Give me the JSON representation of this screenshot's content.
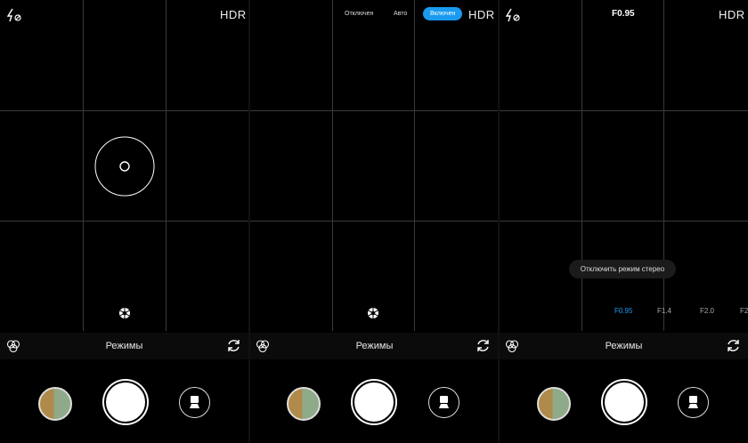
{
  "panels": [
    {
      "flash_icon": "flash-off-icon",
      "hdr": "HDR",
      "modes_label": "Режимы"
    },
    {
      "hdr": "HDR",
      "hdr_options": [
        "Отключен",
        "Авто",
        "Включен"
      ],
      "hdr_selected": "Включен",
      "modes_label": "Режимы"
    },
    {
      "flash_icon": "flash-off-icon",
      "hdr": "HDR",
      "aperture_current": "F0.95",
      "stereo_toggle": "Отключить режим стерео",
      "apertures": [
        "F0.95",
        "F1.4",
        "F2.0",
        "F2"
      ],
      "aperture_selected": "F0.95",
      "modes_label": "Режимы"
    }
  ],
  "colors": {
    "accent": "#1a9bf0",
    "background": "#000000",
    "grid": "#3a3a3a"
  }
}
